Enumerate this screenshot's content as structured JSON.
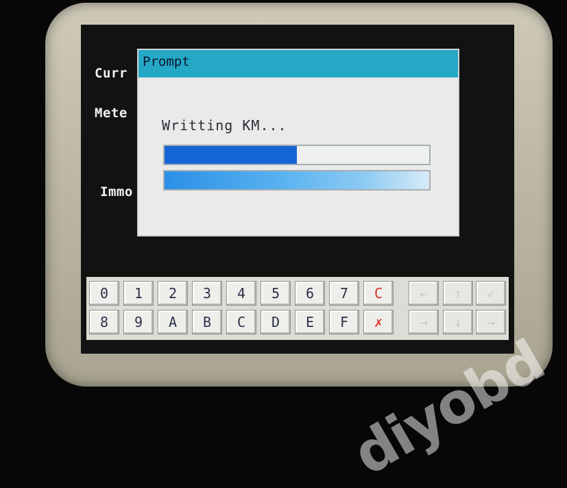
{
  "background_labels": {
    "line1": "Curr",
    "line2": "Mete",
    "line3": "Immo"
  },
  "dialog": {
    "title": "Prompt",
    "message": "Writting KM...",
    "progress_fraction": 0.5
  },
  "keypad": {
    "row1": [
      "0",
      "1",
      "2",
      "3",
      "4",
      "5",
      "6",
      "7",
      "C",
      "←",
      "↑",
      "✓"
    ],
    "row2": [
      "8",
      "9",
      "A",
      "B",
      "C",
      "D",
      "E",
      "F",
      "✗",
      "→",
      "↓",
      "→"
    ]
  },
  "watermark": "diyobd",
  "colors": {
    "title_bar": "#24a8c6",
    "progress_fill": "#1565d6",
    "key_red": "#d8302c"
  }
}
